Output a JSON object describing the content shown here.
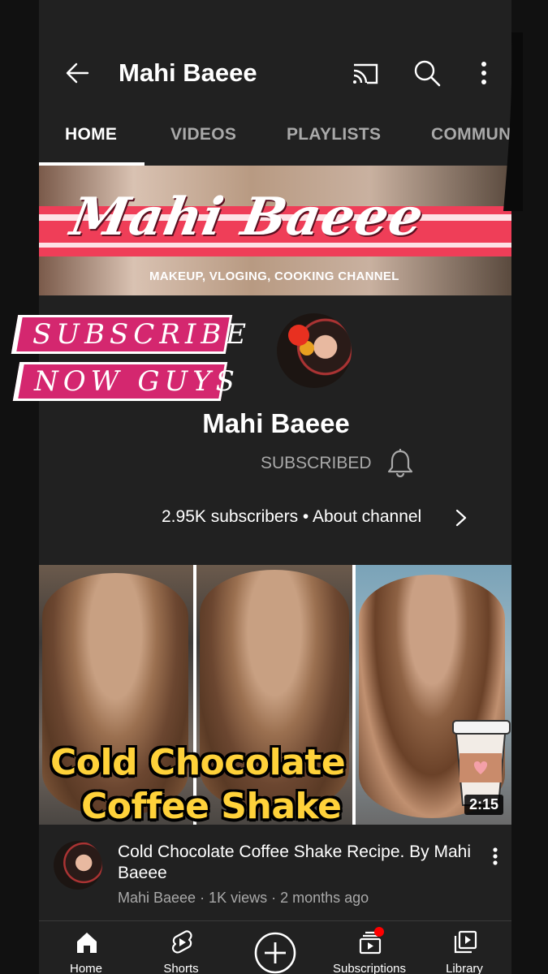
{
  "header": {
    "title": "Mahi Baeee"
  },
  "tabs": [
    {
      "label": "HOME",
      "active": true
    },
    {
      "label": "VIDEOS",
      "active": false
    },
    {
      "label": "PLAYLISTS",
      "active": false
    },
    {
      "label": "COMMUN",
      "active": false
    }
  ],
  "banner": {
    "name": "Mahi Baeee",
    "subtitle": "MAKEUP, VLOGING, COOKING CHANNEL"
  },
  "stickers": {
    "line1": "SUBSCRIBE",
    "line2": "NOW GUYS"
  },
  "channel": {
    "name": "Mahi Baeee",
    "subscribe_state": "SUBSCRIBED",
    "stats": "2.95K subscribers • About channel"
  },
  "video": {
    "thumb_line1": "Cold Chocolate",
    "thumb_line2": "Coffee Shake",
    "duration": "2:15",
    "title": "Cold Chocolate Coffee Shake Recipe. By Mahi Baeee",
    "meta": "Mahi Baeee · 1K views · 2 months ago"
  },
  "bottom_nav": [
    {
      "label": "Home",
      "icon": "home-icon"
    },
    {
      "label": "Shorts",
      "icon": "shorts-icon"
    },
    {
      "label": "",
      "icon": "create-icon"
    },
    {
      "label": "Subscriptions",
      "icon": "subscriptions-icon"
    },
    {
      "label": "Library",
      "icon": "library-icon"
    }
  ],
  "colors": {
    "background": "#212121",
    "sticker": "#d4276f",
    "thumb_text": "#ffd23a",
    "notification": "#ff0000"
  }
}
